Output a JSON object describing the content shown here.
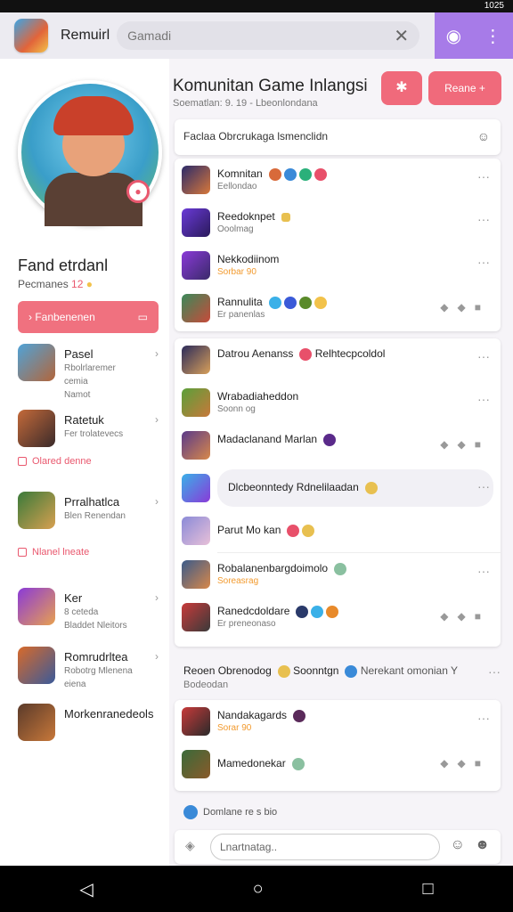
{
  "status": {
    "time": "1025"
  },
  "header": {
    "app_name": "Remuirl",
    "search_placeholder": "Gamadi",
    "clear_icon": "close-icon",
    "action_icons": [
      "chat-icon",
      "more-vertical-icon"
    ]
  },
  "profile": {
    "name": "Fand etrdanl",
    "sub_label": "Pecmanes",
    "sub_count": "12",
    "button_label": "Fanbenenen",
    "items": [
      {
        "t1": "Pasel",
        "t2": "Rbolrlaremer\ncemia\nNamot"
      },
      {
        "t1": "Ratetuk",
        "t2": "Fer trolatevecs"
      }
    ],
    "tag1": "Olared denne",
    "items2": [
      {
        "t1": "Prralhatlca",
        "t2": "Blen Renendan"
      }
    ],
    "tag2": "Nlanel lneate",
    "items3": [
      {
        "t1": "Ker",
        "t2": "8 ceteda\nBladdet Nleitors"
      },
      {
        "t1": "Romrudrltea",
        "t2": "Robotrg Mlenena\neiena"
      },
      {
        "t1": "Morkenranedeols",
        "t2": ""
      }
    ]
  },
  "main": {
    "title": "Komunitan Game Inlangsi",
    "subtitle": "Soematlan: 9. 19 - Lbeonlondana",
    "add_label": "Reane +",
    "filter_text": "Faclaa Obrcrukaga lsmenclidn",
    "group1": [
      {
        "t1": "Komnitan",
        "t2": "Eellondao"
      },
      {
        "t1": "Reedoknpet",
        "t2": "Ooolmag"
      },
      {
        "t1": "Nekkodiinom",
        "t2": "Sorbar 90"
      },
      {
        "t1": "Rannulita",
        "t2": "Er panenlas"
      }
    ],
    "group2": [
      {
        "t1": "Datrou Aenanss",
        "t2": "",
        "t1b": "Relhtecpcoldol"
      },
      {
        "t1": "Wrabadiaheddon",
        "t2": "Soonn og"
      },
      {
        "t1": "Madaclanand Marlan",
        "t2": ""
      },
      {
        "t1": "Dlcbeonntedy Rdnelilaadan",
        "t2": ""
      },
      {
        "t1": "Parut Mo kan",
        "t2": ""
      },
      {
        "t1": "Robalanenbargdoimolo",
        "t2": "Soreasrag"
      },
      {
        "t1": "Ranedcdoldare",
        "t2": "Er preneonaso"
      }
    ],
    "section_title": "Reoen Obrenodog",
    "section_mid": "Soonntgn",
    "section_right": "Nerekant omonian Y",
    "section_sub": "Bodeodan",
    "group3": [
      {
        "t1": "Nandakagards",
        "t2": "Sorar 90"
      },
      {
        "t1": "Mamedonekar",
        "t2": ""
      }
    ],
    "mini_text": "Domlane re s bio",
    "input_placeholder": "Lnartnatag.."
  },
  "colors": {
    "accent": "#f06a7b",
    "purple": "#a77be8"
  }
}
